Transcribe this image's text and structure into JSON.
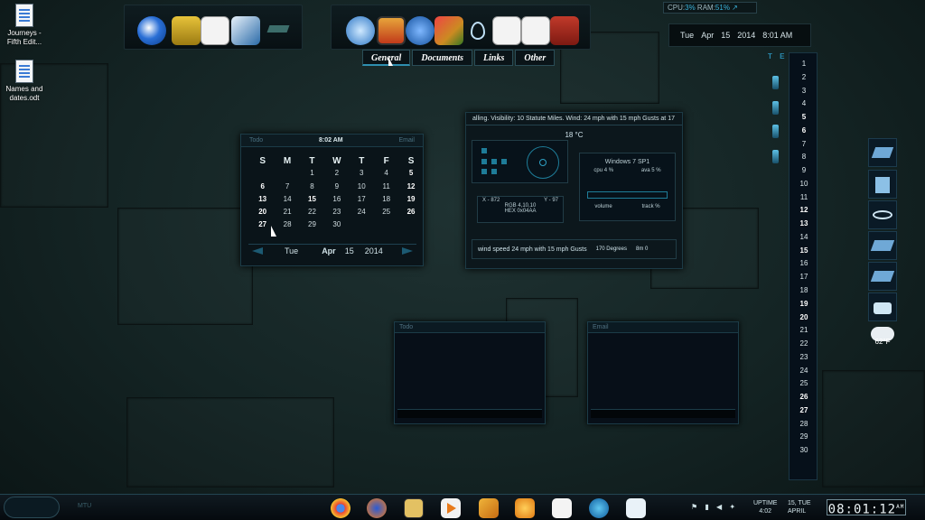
{
  "desktop_icons": [
    {
      "label": "Journeys - Fifth Edit..."
    },
    {
      "label": "Names and dates.odt"
    }
  ],
  "dock_tabs": [
    "General",
    "Documents",
    "Links",
    "Other"
  ],
  "sysmon": {
    "cpu_label": "CPU:",
    "cpu": "3%",
    "ram_label": "RAM:",
    "ram": "51%"
  },
  "datebar": {
    "day": "Tue",
    "month": "Apr",
    "date": "15",
    "year": "2014",
    "time": "8:01 AM"
  },
  "calendar": {
    "todo": "Todo",
    "time": "8:02 AM",
    "email": "Email",
    "headers": [
      "S",
      "M",
      "T",
      "W",
      "T",
      "F",
      "S"
    ],
    "weeks": [
      [
        "",
        "",
        "1",
        "2",
        "3",
        "4",
        "5"
      ],
      [
        "6",
        "7",
        "8",
        "9",
        "10",
        "11",
        "12"
      ],
      [
        "13",
        "14",
        "15",
        "16",
        "17",
        "18",
        "19"
      ],
      [
        "20",
        "21",
        "22",
        "23",
        "24",
        "25",
        "26"
      ],
      [
        "27",
        "28",
        "29",
        "30",
        "",
        "",
        ""
      ]
    ],
    "bold_days": [
      "5",
      "6",
      "12",
      "13",
      "15",
      "19",
      "20",
      "26",
      "27"
    ],
    "footer": {
      "day": "Tue",
      "month": "Apr",
      "date": "15",
      "year": "2014"
    }
  },
  "weather": {
    "ticker": "alling.  Visibility: 10 Statute Miles.  Wind: 24 mph with 15 mph Gusts at 17",
    "temp": "18 °C",
    "os": "Windows 7 SP1",
    "cpu": "cpu 4 %",
    "ava": "ava 5 %",
    "x": "X - 872",
    "y": "Y - 97",
    "rgb": "RGB 4,10,10",
    "hex": "HEX 0x04AA",
    "volume": "volume",
    "track": "track %",
    "wind": "wind speed 24 mph with 15 mph Gusts",
    "degrees": "170 Degrees",
    "speed": "8m 0"
  },
  "te_label": "T E",
  "month_days": [
    "1",
    "2",
    "3",
    "4",
    "5",
    "6",
    "7",
    "8",
    "9",
    "10",
    "11",
    "12",
    "13",
    "14",
    "15",
    "16",
    "17",
    "18",
    "19",
    "20",
    "21",
    "22",
    "23",
    "24",
    "25",
    "26",
    "27",
    "28",
    "29",
    "30"
  ],
  "month_bold": [
    "5",
    "6",
    "12",
    "13",
    "15",
    "19",
    "20",
    "26",
    "27"
  ],
  "weather_tile": "62°F",
  "blank_panels": {
    "todo": "Todo",
    "email": "Email"
  },
  "taskbar": {
    "uptime_label": "UPTIME",
    "uptime": "4:02",
    "date1": "15, TUE",
    "date2": "APRIL",
    "clock": "08:01:12",
    "ampm": "AM",
    "start_text": "MTU"
  }
}
